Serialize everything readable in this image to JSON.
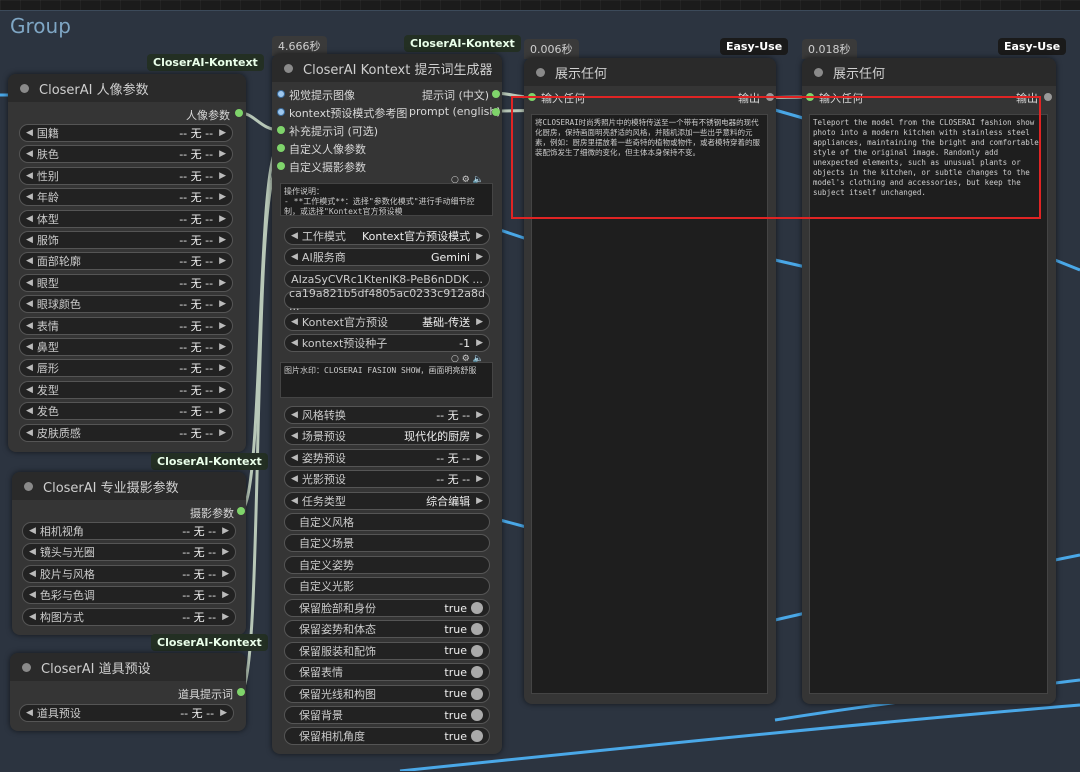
{
  "group": {
    "title": "Group"
  },
  "badges": {
    "person": "CloserAI-Kontext",
    "kontext": "CloserAI-Kontext",
    "photo": "CloserAI-Kontext",
    "props": "CloserAI-Kontext",
    "show1": "Easy-Use",
    "show2": "Easy-Use"
  },
  "timers": {
    "kontext": "4.666秒",
    "show1": "0.006秒",
    "show2": "0.018秒"
  },
  "person_node": {
    "title": "CloserAI 人像参数",
    "output": "人像参数",
    "widgets": [
      {
        "label": "国籍",
        "value": "-- 无 --"
      },
      {
        "label": "肤色",
        "value": "-- 无 --"
      },
      {
        "label": "性别",
        "value": "-- 无 --"
      },
      {
        "label": "年龄",
        "value": "-- 无 --"
      },
      {
        "label": "体型",
        "value": "-- 无 --"
      },
      {
        "label": "服饰",
        "value": "-- 无 --"
      },
      {
        "label": "面部轮廓",
        "value": "-- 无 --"
      },
      {
        "label": "眼型",
        "value": "-- 无 --"
      },
      {
        "label": "眼球颜色",
        "value": "-- 无 --"
      },
      {
        "label": "表情",
        "value": "-- 无 --"
      },
      {
        "label": "鼻型",
        "value": "-- 无 --"
      },
      {
        "label": "唇形",
        "value": "-- 无 --"
      },
      {
        "label": "发型",
        "value": "-- 无 --"
      },
      {
        "label": "发色",
        "value": "-- 无 --"
      },
      {
        "label": "皮肤质感",
        "value": "-- 无 --"
      }
    ]
  },
  "photo_node": {
    "title": "CloserAI 专业摄影参数",
    "output": "摄影参数",
    "widgets": [
      {
        "label": "相机视角",
        "value": "-- 无 --"
      },
      {
        "label": "镜头与光圈",
        "value": "-- 无 --"
      },
      {
        "label": "胶片与风格",
        "value": "-- 无 --"
      },
      {
        "label": "色彩与色调",
        "value": "-- 无 --"
      },
      {
        "label": "构图方式",
        "value": "-- 无 --"
      }
    ]
  },
  "props_node": {
    "title": "CloserAI 道具预设",
    "output": "道具提示词",
    "widgets": [
      {
        "label": "道具预设",
        "value": "-- 无 --"
      }
    ]
  },
  "kontext_node": {
    "title": "CloserAI Kontext 提示词生成器",
    "inputs": [
      "视觉提示图像",
      "kontext预设模式参考图",
      "补充提示词 (可选)",
      "自定义人像参数",
      "自定义摄影参数"
    ],
    "outputs": [
      "提示词 (中文)",
      "prompt (english)"
    ],
    "instructions": "操作说明：\n- **工作模式**：选择\"参数化模式\"进行手动细节控制，或选择\"Kontext官方预设模",
    "widgets_a": [
      {
        "label": "工作模式",
        "value": "Kontext官方预设模式"
      },
      {
        "label": "AI服务商",
        "value": "Gemini"
      }
    ],
    "api_key": "AIzaSyCVRc1KtenlK8-PeB6nDDK ...",
    "secret": "ca19a821b5df4805ac0233c912a8d ...",
    "widgets_b": [
      {
        "label": "Kontext官方预设",
        "value": "基础-传送"
      },
      {
        "label": "kontext预设种子",
        "value": "-1"
      }
    ],
    "watermark": "图片水印：CLOSERAI FASION SHOW，画面明亮舒服",
    "widgets_c": [
      {
        "label": "风格转换",
        "value": "-- 无 --"
      },
      {
        "label": "场景预设",
        "value": "现代化的厨房"
      },
      {
        "label": "姿势预设",
        "value": "-- 无 --"
      },
      {
        "label": "光影预设",
        "value": "-- 无 --"
      },
      {
        "label": "任务类型",
        "value": "综合编辑"
      }
    ],
    "custom": [
      "自定义风格",
      "自定义场景",
      "自定义姿势",
      "自定义光影"
    ],
    "toggles": [
      {
        "label": "保留脸部和身份",
        "value": "true"
      },
      {
        "label": "保留姿势和体态",
        "value": "true"
      },
      {
        "label": "保留服装和配饰",
        "value": "true"
      },
      {
        "label": "保留表情",
        "value": "true"
      },
      {
        "label": "保留光线和构图",
        "value": "true"
      },
      {
        "label": "保留背景",
        "value": "true"
      },
      {
        "label": "保留相机角度",
        "value": "true"
      }
    ]
  },
  "show1": {
    "title": "展示任何",
    "input": "输入任何",
    "output": "输出",
    "text": "将CLOSERAI时尚秀照片中的模特传送至一个带有不锈钢电器的现代化厨房，保持画面明亮舒适的风格，并随机添加一些出乎意料的元素，例如：厨房里摆放着一些奇特的植物或物件，或者模特穿着的服装配饰发生了细微的变化，但主体本身保持不变。"
  },
  "show2": {
    "title": "展示任何",
    "input": "输入任何",
    "output": "输出",
    "text": "Teleport the model from the CLOSERAI fashion show photo into a modern kitchen with stainless steel appliances, maintaining the bright and comfortable style of the original image. Randomly add unexpected elements, such as unusual plants or objects in the kitchen, or subtle changes to the model's clothing and accessories, but keep the subject itself unchanged."
  }
}
